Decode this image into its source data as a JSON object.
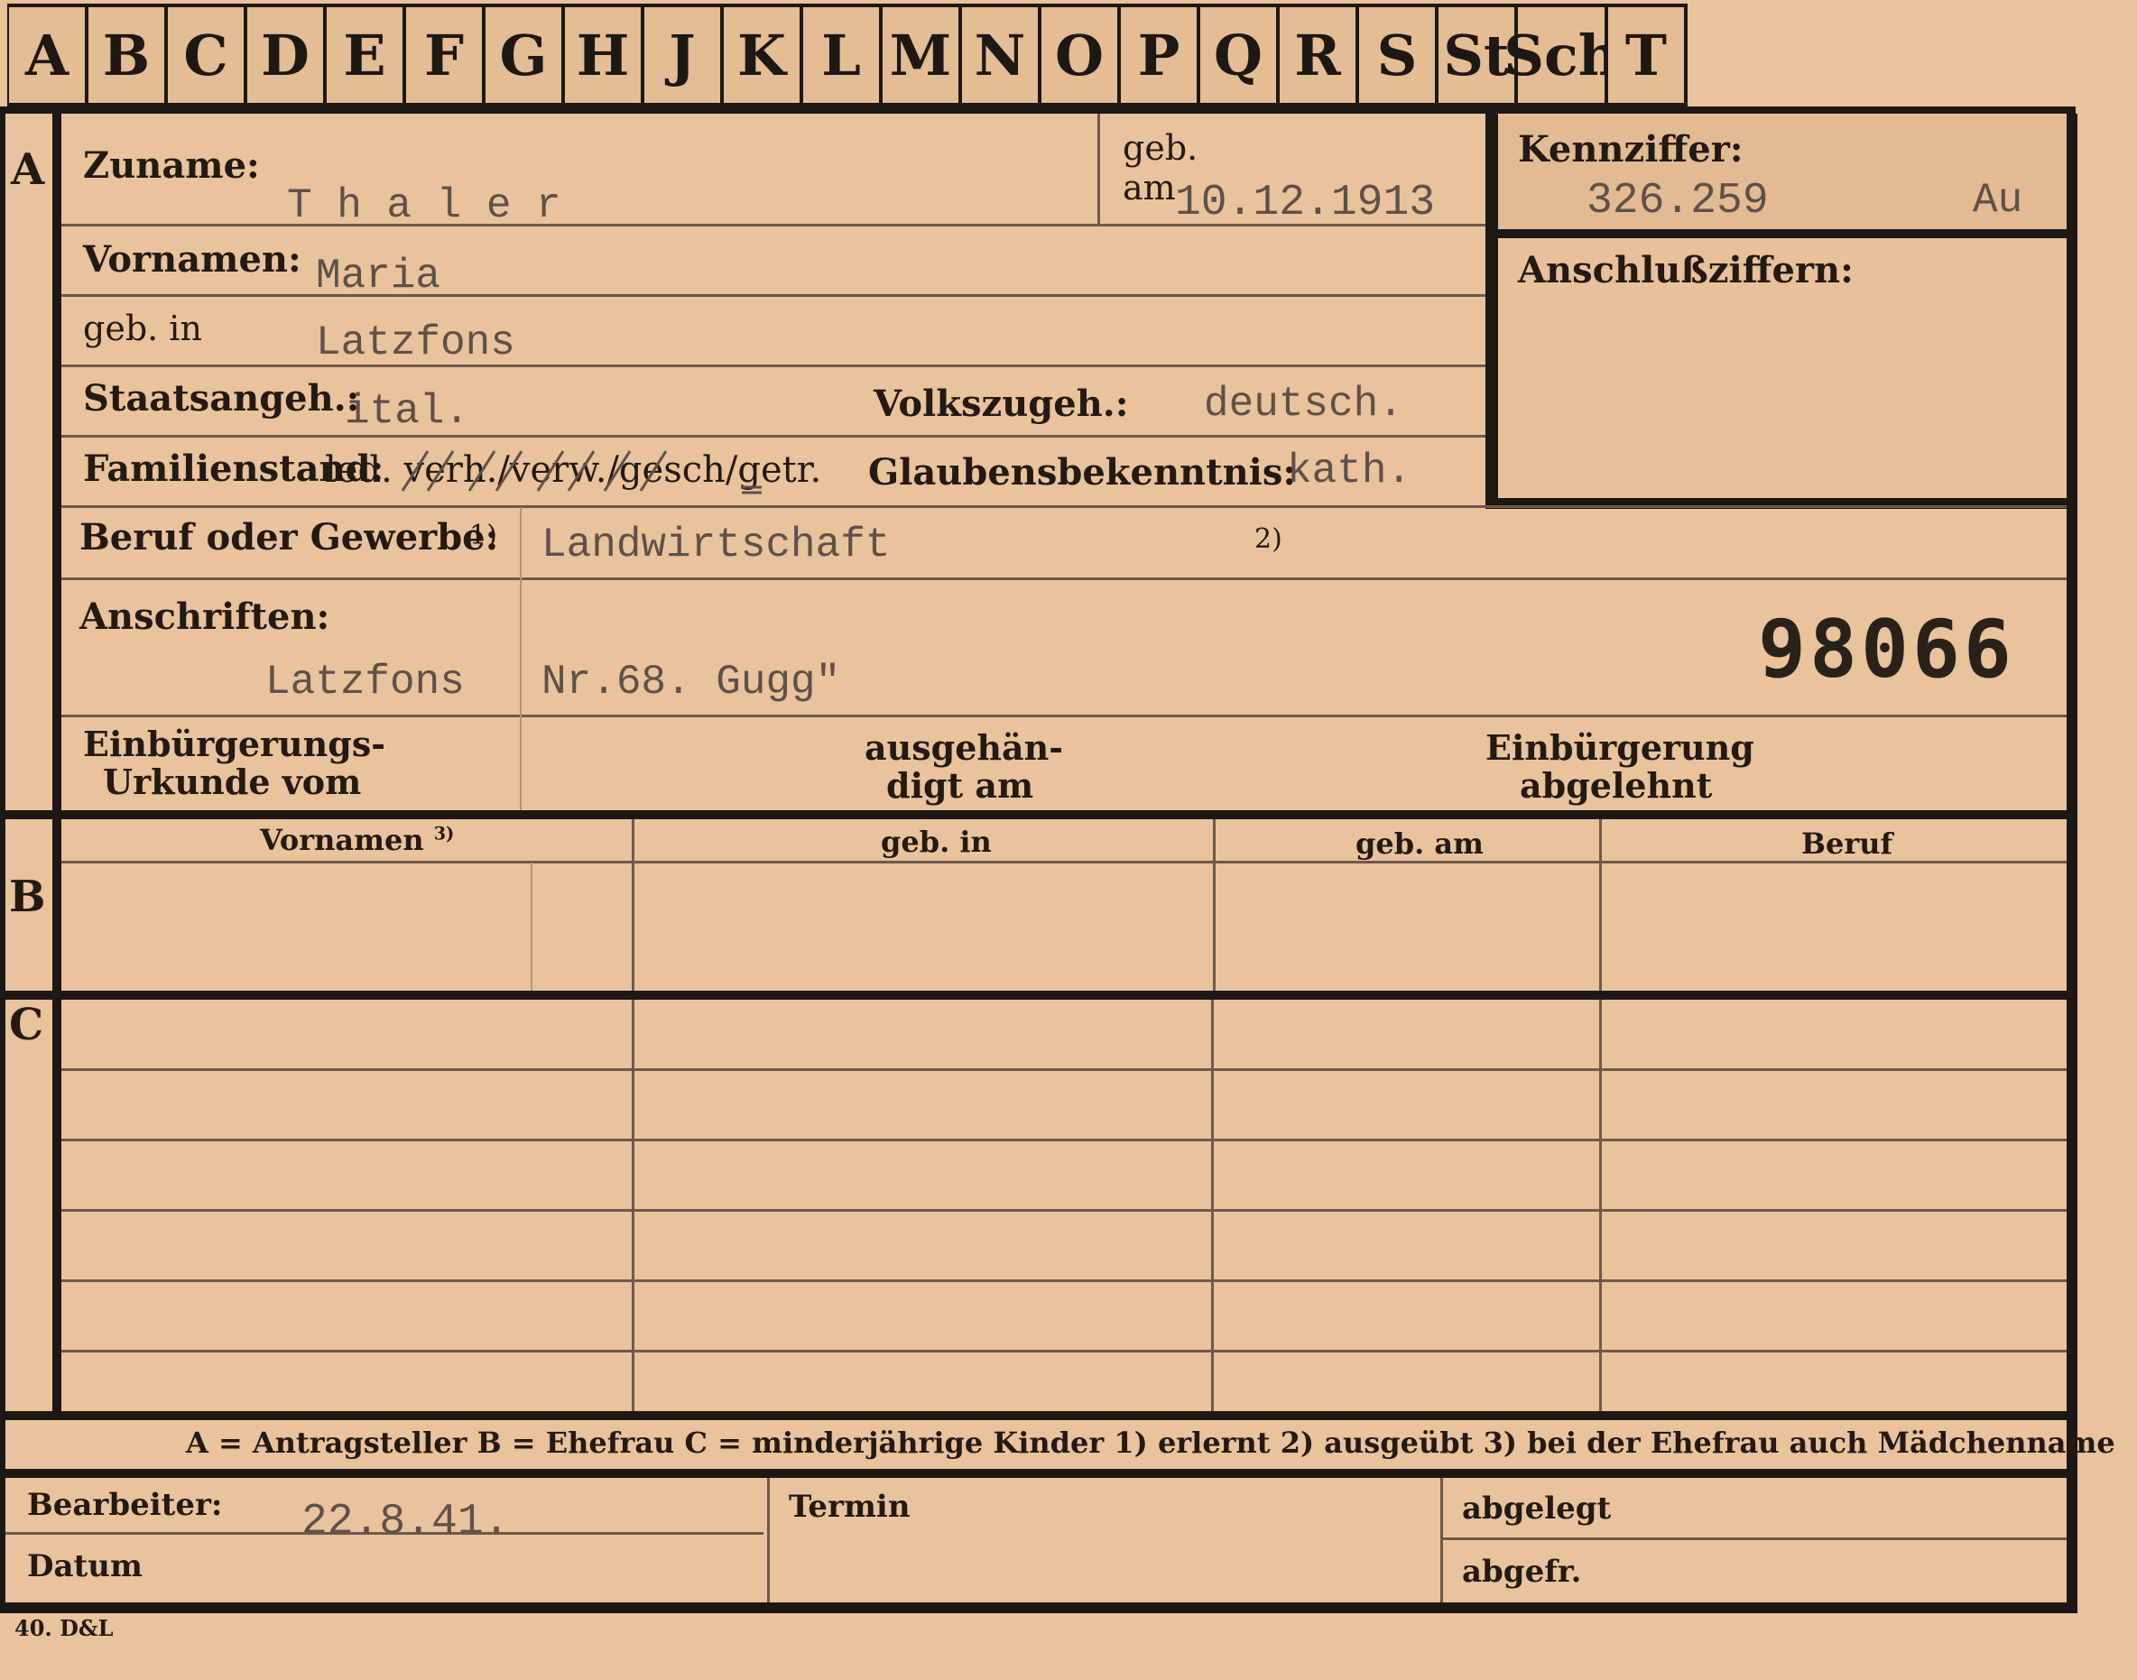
{
  "tabs": [
    "A",
    "B",
    "C",
    "D",
    "E",
    "F",
    "G",
    "H",
    "J",
    "K",
    "L",
    "M",
    "N",
    "O",
    "P",
    "Q",
    "R",
    "S",
    "St",
    "Sch",
    "T"
  ],
  "sections": {
    "a": "A",
    "b": "B",
    "c": "C"
  },
  "fields": {
    "zuname_label": "Zuname:",
    "zuname_value": "T h a l e r",
    "geb_label": "geb.",
    "am_label": "am",
    "geb_am_value": "10.12.1913",
    "kennziffer_label": "Kennziffer:",
    "kennziffer_value": "326.259",
    "kennziffer_suffix": "Au",
    "anschluss_label": "Anschlußziffern:",
    "vornamen_label": "Vornamen:",
    "vornamen_value": "Maria",
    "geb_in_label": "geb. in",
    "geb_in_value": "Latzfons",
    "staatsangeh_label": "Staatsangeh.:",
    "staatsangeh_value": "ital.",
    "volkszugeh_label": "Volkszugeh.:",
    "volkszugeh_value": "deutsch.",
    "familienstand_label": "Familienstand:",
    "familienstand_options": "led. verh./verw./gesch/getr.",
    "glaubens_label": "Glaubensbekenntnis:",
    "glaubens_value": "kath.",
    "beruf_label": "Beruf oder Gewerbe:",
    "beruf_fn1": "1)",
    "beruf_value": "Landwirtschaft",
    "beruf_fn2": "2)",
    "anschriften_label": "Anschriften:",
    "anschrift_place": "Latzfons",
    "anschrift_detail": "Nr.68.  Gugg\"",
    "stamp_number": "98066",
    "einb_urkunde_line1": "Einbürgerungs-",
    "einb_urkunde_line2": "Urkunde vom",
    "ausgeh_line1": "ausgehän-",
    "ausgeh_line2": "digt am",
    "einb_abgelehnt_line1": "Einbürgerung",
    "einb_abgelehnt_line2": "abgelehnt"
  },
  "table_headers": [
    "Vornamen",
    "geb. in",
    "geb. am",
    "Beruf"
  ],
  "table_header_fn": "3)",
  "legend": "A = Antragsteller   B = Ehefrau   C = minderjährige Kinder   1) erlernt   2) ausgeübt   3) bei der Ehefrau auch Mädchenname",
  "footer": {
    "bearbeiter_label": "Bearbeiter:",
    "bearbeiter_value": "22.8.41.",
    "datum_label": "Datum",
    "termin_label": "Termin",
    "abgelegt_label": "abgelegt",
    "abgefr_label": "abgefr."
  },
  "printer_mark": "40. D&L"
}
